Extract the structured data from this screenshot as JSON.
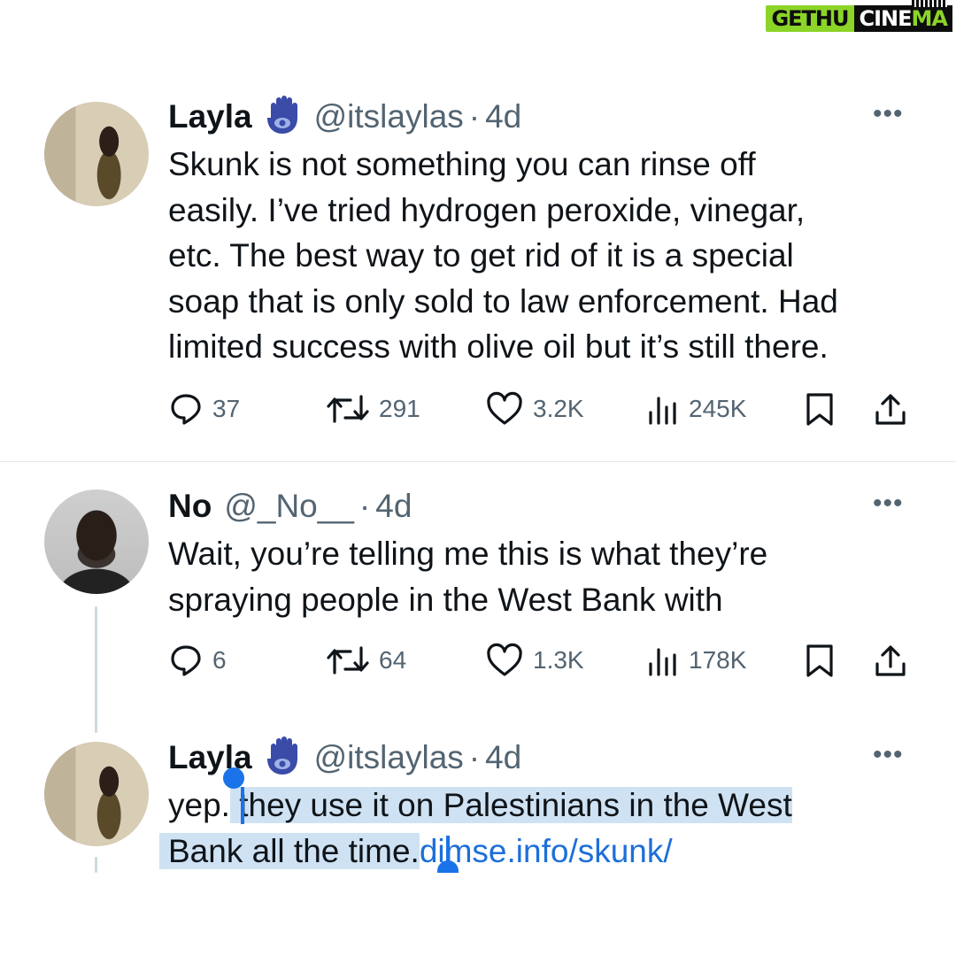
{
  "watermark": {
    "part1": "GETHU",
    "part2a": "CINE",
    "part2b": "MA"
  },
  "tweets": [
    {
      "name": "Layla",
      "badge": "hamsa-icon",
      "handle": "@itslaylas",
      "sep": "·",
      "time": "4d",
      "lines": [
        "Skunk is not something you can rinse off",
        "easily. I’ve tried hydrogen peroxide, vinegar,",
        "etc. The best way to get rid of it is a special",
        "soap that is only sold to law enforcement. Had",
        "limited success with olive oil but it’s still there."
      ],
      "replies": "37",
      "reposts": "291",
      "likes": "3.2K",
      "views": "245K"
    },
    {
      "name": "No",
      "handle": "@_No__",
      "sep": "·",
      "time": "4d",
      "lines": [
        "Wait, you’re telling me this is what they’re",
        "spraying people in the West Bank with"
      ],
      "replies": "6",
      "reposts": "64",
      "likes": "1.3K",
      "views": "178K"
    },
    {
      "name": "Layla",
      "badge": "hamsa-icon",
      "handle": "@itslaylas",
      "sep": "·",
      "time": "4d",
      "line1_pre": "yep.",
      "line1_sel": " they use it on Palestinians in the West",
      "line2_sel": "Bank all the time.",
      "link": "dimse.info/skunk/"
    }
  ],
  "colors": {
    "text": "#0f1419",
    "secondary": "#536471",
    "badge": "#3a4ba8",
    "selection": "#cfe2f3",
    "link": "#1d6fd9"
  }
}
